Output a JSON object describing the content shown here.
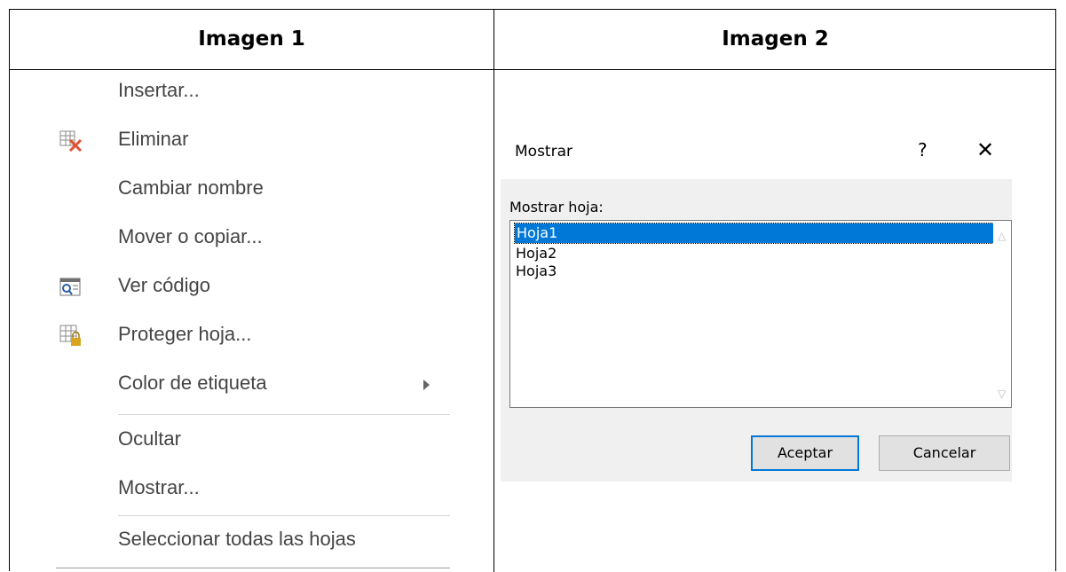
{
  "columns": {
    "left_title": "Imagen 1",
    "right_title": "Imagen 2"
  },
  "context_menu": {
    "items": [
      {
        "label": "Insertar...",
        "icon": null
      },
      {
        "label": "Eliminar",
        "icon": "delete-sheet-icon"
      },
      {
        "label": "Cambiar nombre",
        "icon": null
      },
      {
        "label": "Mover o copiar...",
        "icon": null
      },
      {
        "label": "Ver código",
        "icon": "view-code-icon"
      },
      {
        "label": "Proteger hoja...",
        "icon": "protect-sheet-icon"
      },
      {
        "label": "Color de etiqueta",
        "icon": null,
        "submenu": true
      },
      {
        "label": "Ocultar",
        "icon": null
      },
      {
        "label": "Mostrar...",
        "icon": null
      },
      {
        "label": "Seleccionar todas las hojas",
        "icon": null
      }
    ]
  },
  "dialog": {
    "title": "Mostrar",
    "help_label": "?",
    "close_label": "✕",
    "list_label": "Mostrar hoja:",
    "sheets": [
      "Hoja1",
      "Hoja2",
      "Hoja3"
    ],
    "selected_sheet": "Hoja1",
    "ok_label": "Aceptar",
    "cancel_label": "Cancelar"
  },
  "colors": {
    "selection": "#0078d7",
    "dialog_bg": "#f0f0f0",
    "delete_icon": "#e0512f",
    "lock_icon": "#d9a520"
  }
}
